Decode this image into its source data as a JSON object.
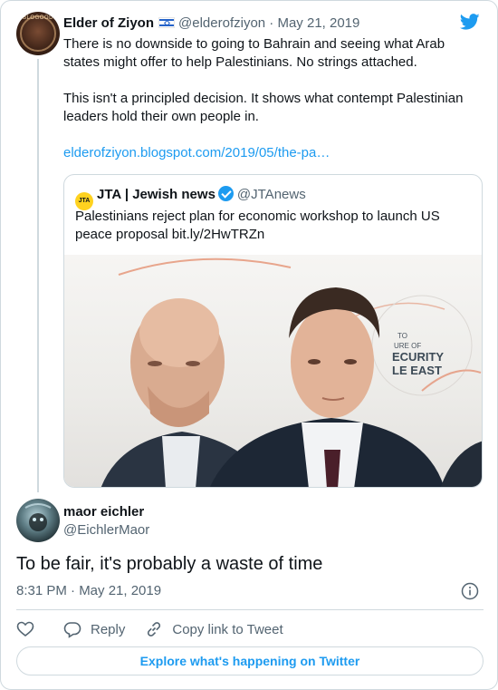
{
  "parent_tweet": {
    "avatar_text": "BLOGOOD",
    "author_name": "Elder of Ziyon",
    "flag_icon": "israel-flag",
    "handle": "@elderofziyon",
    "separator": "·",
    "date": "May 21, 2019",
    "paragraph_1": "There is no downside to going to Bahrain and seeing what Arab states might offer to help Palestinians. No strings attached.",
    "paragraph_2": "This isn't a principled decision. It shows what contempt Palestinian leaders hold their own people in.",
    "link": "elderofziyon.blogspot.com/2019/05/the-pa…"
  },
  "quoted_tweet": {
    "avatar_text": "JTA",
    "author_name": "JTA | Jewish news",
    "handle": "@JTAnews",
    "text": "Palestinians reject plan for economic workshop to launch US peace proposal bit.ly/2HwTRZn",
    "photo_sign": [
      "TO",
      "URE OF",
      "ECURITY",
      "LE EAST"
    ]
  },
  "reply_tweet": {
    "author_name": "maor eichler",
    "handle": "@EichlerMaor",
    "text": "To be fair, it's probably a waste of time",
    "timestamp": "8:31 PM · May 21, 2019"
  },
  "actions": {
    "like_icon": "heart-icon",
    "reply_label": "Reply",
    "copy_label": "Copy link to Tweet"
  },
  "explore_label": "Explore what's happening on Twitter",
  "colors": {
    "accent": "#1d9bf0",
    "text": "#0f1419",
    "muted": "#536471",
    "border": "#cfd9de"
  }
}
